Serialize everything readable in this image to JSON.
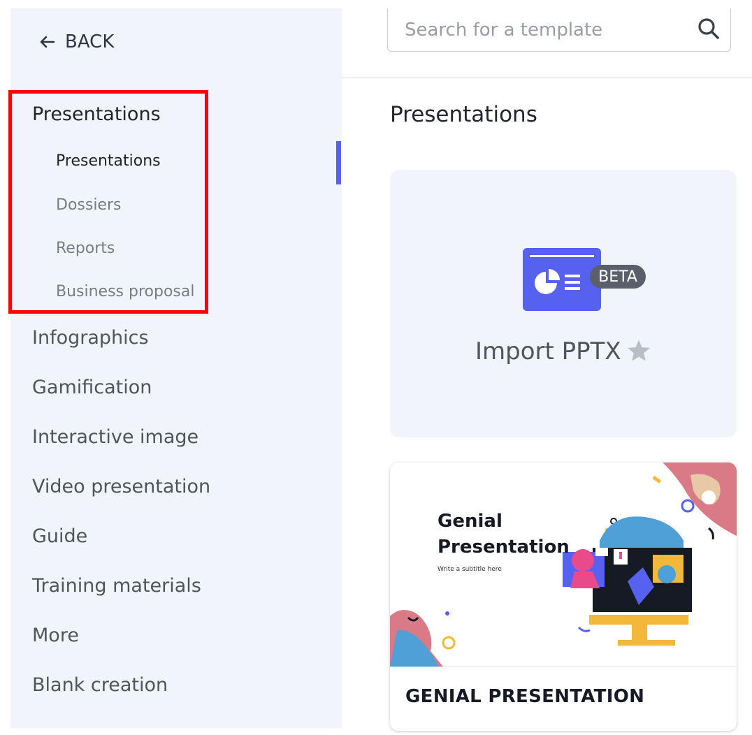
{
  "sidebar": {
    "back_label": "BACK",
    "section_title": "Presentations",
    "sub_items": [
      {
        "label": "Presentations",
        "active": true
      },
      {
        "label": "Dossiers"
      },
      {
        "label": "Reports"
      },
      {
        "label": "Business proposal"
      }
    ],
    "items": [
      {
        "label": "Infographics"
      },
      {
        "label": "Gamification"
      },
      {
        "label": "Interactive image"
      },
      {
        "label": "Video presentation"
      },
      {
        "label": "Guide"
      },
      {
        "label": "Training materials"
      },
      {
        "label": "More"
      },
      {
        "label": "Blank creation"
      }
    ]
  },
  "search": {
    "placeholder": "Search for a template",
    "icon": "search-icon"
  },
  "main": {
    "title": "Presentations",
    "import_card": {
      "label": "Import PPTX",
      "badge": "BETA",
      "icon": "presentation-chart-icon",
      "favorite_icon": "star-icon"
    },
    "template_card": {
      "thumb_title_line1": "Genial",
      "thumb_title_line2": "Presentation",
      "thumb_subtitle": "Write a subtitle here",
      "name": "GENIAL PRESENTATION"
    }
  },
  "colors": {
    "accent": "#5661f0",
    "sidebar_bg": "#f1f4fb",
    "highlight": "#ff0000",
    "badge_bg": "#5a5f69"
  }
}
